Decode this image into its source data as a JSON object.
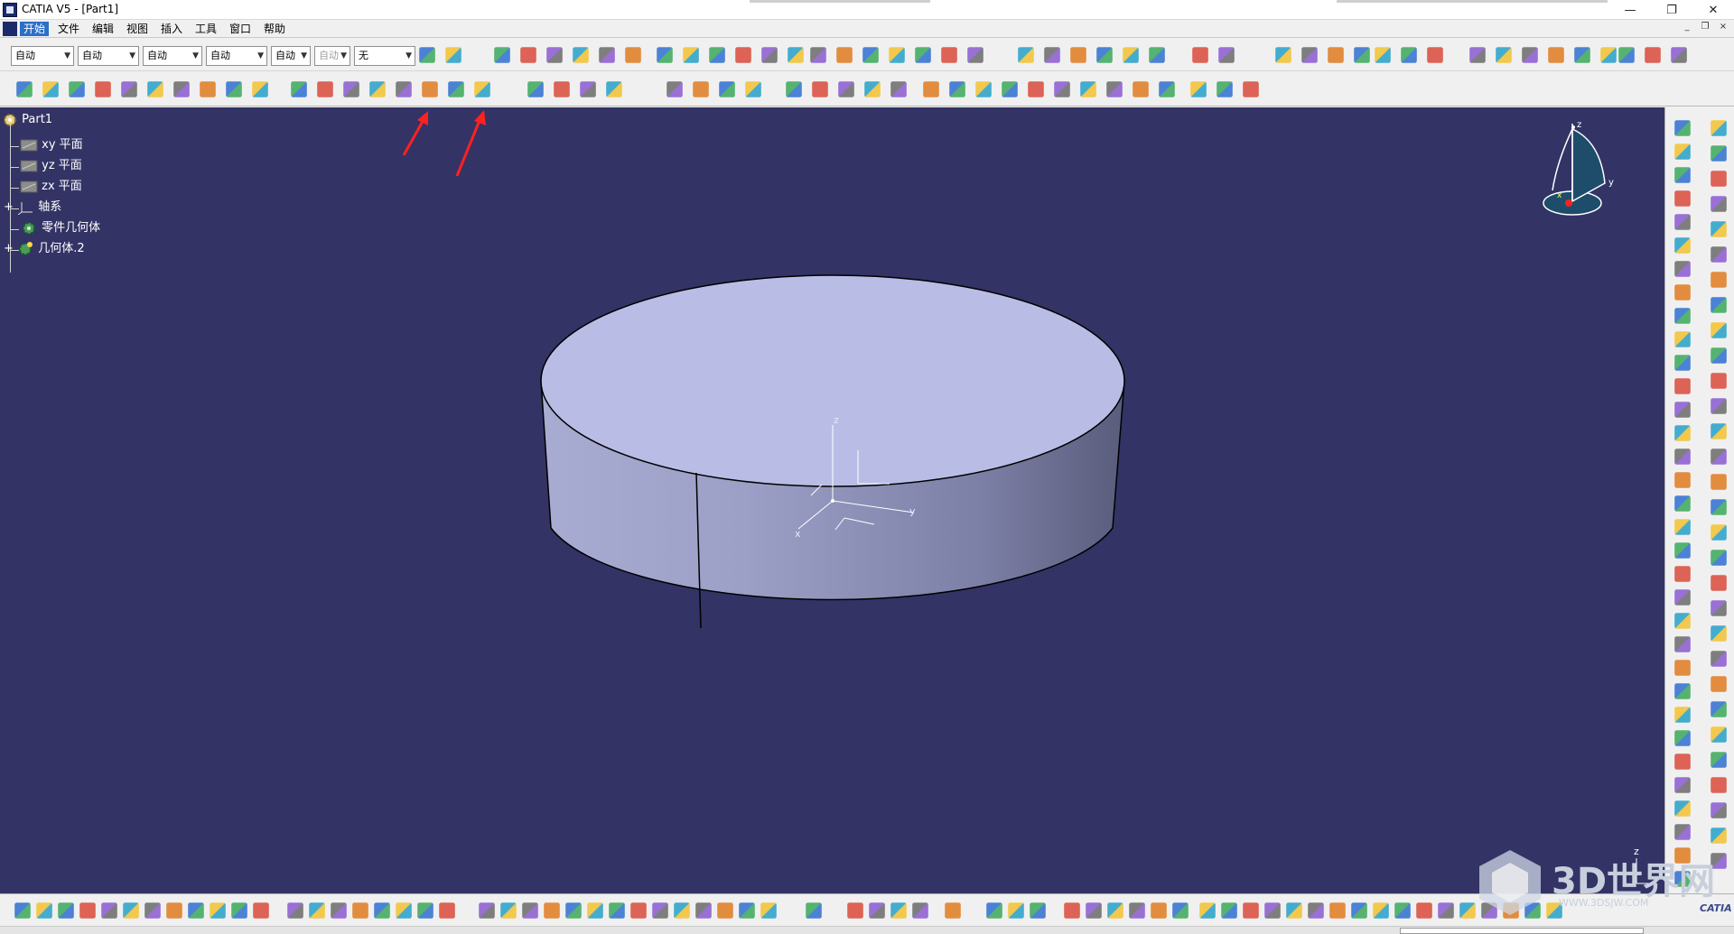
{
  "window": {
    "title": "CATIA V5 - [Part1]",
    "controls": {
      "minimize": "—",
      "restore": "❐",
      "close": "✕"
    }
  },
  "menu": {
    "items": [
      "开始",
      "文件",
      "编辑",
      "视图",
      "插入",
      "工具",
      "窗口",
      "帮助"
    ],
    "active": "开始",
    "mdi_controls": {
      "minimize": "_",
      "restore": "❐",
      "close": "×"
    }
  },
  "toolbar_combos": [
    {
      "value": "自动",
      "disabled": false
    },
    {
      "value": "自动",
      "disabled": false
    },
    {
      "value": "自动",
      "disabled": false
    },
    {
      "value": "自动",
      "disabled": false
    },
    {
      "value": "自动",
      "disabled": false
    },
    {
      "value": "自动",
      "disabled": true
    },
    {
      "value": "无",
      "disabled": false
    }
  ],
  "spec_tree": {
    "root": "Part1",
    "items": [
      {
        "label": "xy 平面",
        "icon": "plane-icon"
      },
      {
        "label": "yz 平面",
        "icon": "plane-icon"
      },
      {
        "label": "zx 平面",
        "icon": "plane-icon"
      },
      {
        "label": "轴系",
        "icon": "axis-system-icon"
      },
      {
        "label": "零件几何体",
        "icon": "part-body-icon"
      },
      {
        "label": "几何体.2",
        "icon": "body-icon"
      }
    ]
  },
  "model": {
    "shape": "cylinder",
    "axis_labels": {
      "x": "x",
      "y": "y",
      "z": "z"
    }
  },
  "compass": {
    "x": "x",
    "y": "y",
    "z": "z"
  },
  "corner_axis": {
    "z": "z"
  },
  "watermark": {
    "text": "3D世界网",
    "url": "WWW.3DSJW.COM"
  },
  "brand": "CATIA",
  "colors": {
    "viewport_bg": "#333366",
    "solid_top": "#b9bde6",
    "solid_side_light": "#a7aacf",
    "solid_side_dark": "#5d5f80",
    "annotation_arrow": "#ff2020",
    "menu_active": "#2b6fc6"
  }
}
